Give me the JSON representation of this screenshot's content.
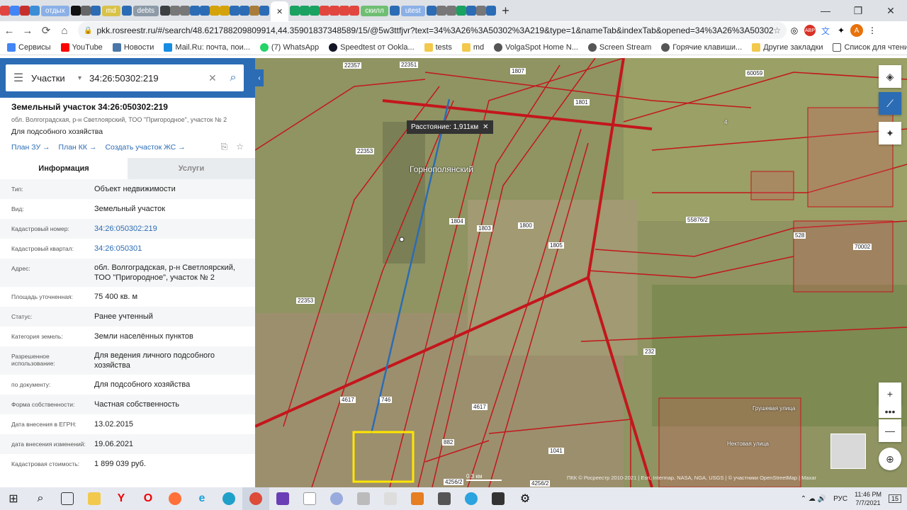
{
  "browser": {
    "tabs": [
      {
        "label": "отдых",
        "style": "blue"
      },
      {
        "label": "md",
        "style": "yellow"
      },
      {
        "label": "debts",
        "style": "gray"
      },
      {
        "label": "скилл",
        "style": "green"
      },
      {
        "label": "utest",
        "style": "blue"
      }
    ],
    "url": "pkk.rosreestr.ru/#/search/48.621788209809914,44.35901837348589/15/@5w3ttfjvr?text=34%3A26%3A50302%3A219&type=1&nameTab&indexTab&opened=34%3A26%3A50302%3A219",
    "bookmarks": [
      {
        "label": "Сервисы",
        "color": "#4285f4"
      },
      {
        "label": "YouTube",
        "color": "#ff0000"
      },
      {
        "label": "Новости",
        "color": "#4a76a8"
      },
      {
        "label": "Mail.Ru: почта, пои...",
        "color": "#168de2"
      },
      {
        "label": "(7) WhatsApp",
        "color": "#25d366"
      },
      {
        "label": "Speedtest от Ookla...",
        "color": "#141526"
      },
      {
        "label": "tests",
        "color": "#f2c94c"
      },
      {
        "label": "md",
        "color": "#f2c94c"
      },
      {
        "label": "VolgaSpot Home N...",
        "color": "#555555"
      },
      {
        "label": "Screen Stream",
        "color": "#555555"
      },
      {
        "label": "Горячие клавиши...",
        "color": "#555555"
      }
    ],
    "bookmarks_right": [
      {
        "label": "Другие закладки"
      },
      {
        "label": "Список для чтения"
      }
    ],
    "avatar": "A"
  },
  "search": {
    "type": "Участки",
    "query": "34:26:50302:219"
  },
  "parcel": {
    "title": "Земельный участок 34:26:050302:219",
    "address": "обл. Волгоградская, р-н Светлоярский, ТОО \"Пригородное\", участок № 2",
    "purpose": "Для подсобного хозяйства",
    "links": [
      "План ЗУ →",
      "План КК →",
      "Создать участок ЖС →"
    ],
    "tabs": {
      "info": "Информация",
      "services": "Услуги"
    },
    "rows": [
      {
        "k": "Тип:",
        "v": "Объект недвижимости",
        "link": false
      },
      {
        "k": "Вид:",
        "v": "Земельный участок",
        "link": false
      },
      {
        "k": "Кадастровый номер:",
        "v": "34:26:050302:219",
        "link": true
      },
      {
        "k": "Кадастровый квартал:",
        "v": "34:26:050301",
        "link": true
      },
      {
        "k": "Адрес:",
        "v": "обл. Волгоградская, р-н Светлоярский, ТОО \"Пригородное\", участок № 2",
        "link": false
      },
      {
        "k": "Площадь уточненная:",
        "v": "75 400 кв. м",
        "link": false
      },
      {
        "k": "Статус:",
        "v": "Ранее учтенный",
        "link": false
      },
      {
        "k": "Категория земель:",
        "v": "Земли населённых пунктов",
        "link": false
      },
      {
        "k": "Разрешенное использование:",
        "v": "Для ведения личного подсобного хозяйства",
        "link": false
      },
      {
        "k": "по документу:",
        "v": "Для подсобного хозяйства",
        "link": false
      },
      {
        "k": "Форма собственности:",
        "v": "Частная собственность",
        "link": false
      },
      {
        "k": "Дата внесения в ЕГРН:",
        "v": "13.02.2015",
        "link": false
      },
      {
        "k": "дата внесения изменений:",
        "v": "19.06.2021",
        "link": false
      },
      {
        "k": "Кадастровая стоимость:",
        "v": "1 899 039 руб.",
        "link": false
      }
    ]
  },
  "map": {
    "distance_tooltip": "Расстояние: 1,911км",
    "place_name": "Горнополянский",
    "labels": [
      {
        "text": "22351"
      },
      {
        "text": "1807"
      },
      {
        "text": "60059"
      },
      {
        "text": "1801"
      },
      {
        "text": "4"
      },
      {
        "text": "22353"
      },
      {
        "text": "1804"
      },
      {
        "text": "1803"
      },
      {
        "text": "1800"
      },
      {
        "text": "1805"
      },
      {
        "text": "55876/2"
      },
      {
        "text": "528"
      },
      {
        "text": "22353"
      },
      {
        "text": "232"
      },
      {
        "text": "746"
      },
      {
        "text": "882"
      },
      {
        "text": "1041"
      },
      {
        "text": "4256/2"
      },
      {
        "text": "4256/2"
      },
      {
        "text": "4617"
      },
      {
        "text": "4617"
      },
      {
        "text": "70002"
      },
      {
        "text": "22357"
      }
    ],
    "street_labels": [
      "Грушевая улица",
      "Нектовая улица"
    ],
    "scale": "0.3 км",
    "copyright": "ПКК © Росреестр 2010-2021 | Esri, Intermap, NASA, NGA, USGS | © участники OpenStreetMap | Maxar"
  },
  "taskbar": {
    "lang": "РУС",
    "time": "11:46 PM",
    "date": "7/7/2021",
    "notifications": "15"
  }
}
